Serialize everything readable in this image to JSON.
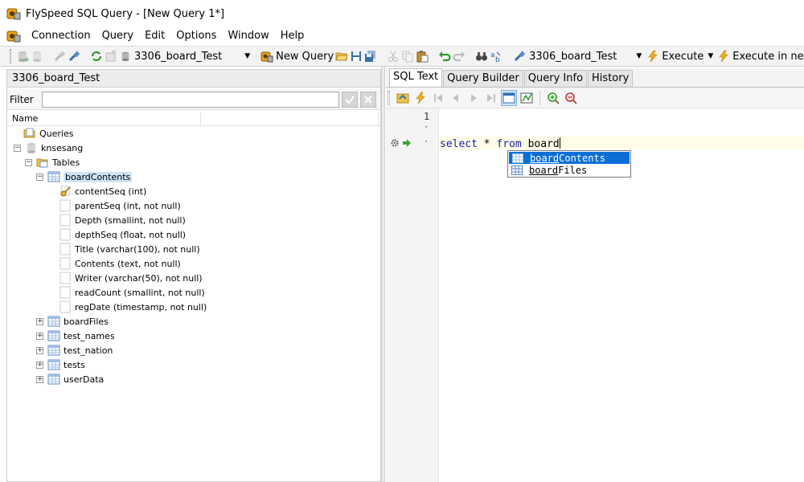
{
  "window": {
    "title": "FlySpeed SQL Query  - [New Query 1*]"
  },
  "menu": {
    "items": [
      "Connection",
      "Query",
      "Edit",
      "Options",
      "Window",
      "Help"
    ]
  },
  "toolbar": {
    "connection_combo": "3306_board_Test",
    "new_query_label": "New Query",
    "query_connection_combo": "3306_board_Test",
    "execute_label": "Execute",
    "execute_in_new_label": "Execute in new"
  },
  "left_panel": {
    "title": "3306_board_Test",
    "filter_label": "Filter",
    "filter_value": "",
    "column_header": "Name",
    "tree": {
      "queries": "Queries",
      "database": "knsesang",
      "tables": "Tables",
      "selected_table": "boardContents",
      "columns": [
        "contentSeq (int)",
        "parentSeq (int, not null)",
        "Depth (smallint, not null)",
        "depthSeq (float, not null)",
        "Title (varchar(100), not null)",
        "Contents (text, not null)",
        "Writer (varchar(50), not null)",
        "readCount (smallint, not null)",
        "regDate (timestamp, not null)"
      ],
      "other_tables": [
        "boardFiles",
        "test_names",
        "test_nation",
        "tests",
        "userData"
      ]
    }
  },
  "right_panel": {
    "tabs": [
      "SQL Text",
      "Query Builder",
      "Query Info",
      "History"
    ],
    "active_tab": "SQL Text",
    "editor": {
      "line_number": "1",
      "code_keyword_select": "select",
      "code_star": " * ",
      "code_keyword_from": "from",
      "code_table": " board"
    },
    "autocomplete": {
      "typed_prefix": "board",
      "items": [
        {
          "prefix": "board",
          "rest": "Contents"
        },
        {
          "prefix": "board",
          "rest": "Files"
        }
      ]
    }
  },
  "colors": {
    "selection_highlight": "#0b6fd6",
    "tree_selected": "#cde4f7",
    "keyword": "#1a1aa6"
  }
}
